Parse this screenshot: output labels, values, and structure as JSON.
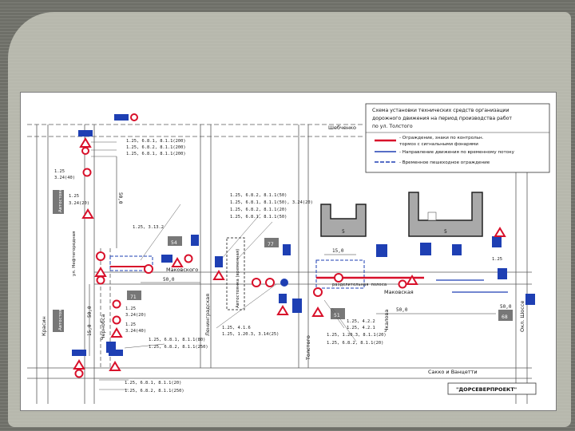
{
  "legend": {
    "title_lines": [
      "Схема установки технических средств организации",
      "дорожного движения на период производства работ",
      "по ул. Толстого"
    ],
    "items": [
      "- Ограждение, знаки по контрольн.",
      "тормоз с сигнальными фонарями",
      "- Направление движения по временному потоку",
      "- Временное пешеходное ограждение"
    ]
  },
  "streets": {
    "top": "Шебченко",
    "makovskogo_left": "Маковского",
    "makovskogo_right": "Маковская",
    "chernovsa": "Чернобса",
    "leningradskaya": "Ленинградская",
    "tolstogo": "Толстого",
    "sakko": "Сакко и Ванцетти",
    "chkalov": "Чкалова",
    "krasin": "Красин",
    "bottom_right_vert": "Окл. Шоссе"
  },
  "tall_labels": {
    "left_mid": "Автостоянка",
    "left_low": "Автостоянка",
    "center_box": "Автостоянка (временная)",
    "left_vert_street": "ул. Нефтегородная"
  },
  "building_numbers": {
    "b54": "54",
    "b77": "77",
    "b71": "71",
    "b51": "51",
    "b68": "68",
    "b5a": "5",
    "b5b": "5"
  },
  "dimensions": {
    "d500_h1": "50,0",
    "d500_h2": "50,0",
    "d500_v1": "50,0",
    "d500_v2": "50,0",
    "d150": "15,0",
    "d150_b": "15,0",
    "d500_right": "50,0"
  },
  "sign_notes": {
    "n1": "1.25,  6.8.1, 8.1.1(200)",
    "n2": "1.25,  6.8.2, 8.1.1(200)",
    "n3": "1.25,  6.8.1, 8.1.1(200)",
    "n4": "1.25,  3.13.2",
    "n5": "1.25,  6.8.2, 8.1.1(50)",
    "n6": "1.25,  6.8.1, 8.1.1(50), 3.24(20)",
    "n7": "1.25,  6.8.2, 8.1.1(20)",
    "n8": "1.25,  6.8.1, 8.1.1(50)",
    "n9": "1.25",
    "n10": "3.24(40)",
    "n11": "1.25",
    "n12": "3.24(20)",
    "n13": "1.25,  6.8.1, 8.1.1(20)",
    "n14": "1.25,  6.8.2, 8.1.1(250)",
    "n15": "1.25,  4.1.6",
    "n16": "1.25,  1.20.3, 3.14(25)",
    "n17": "1.25,  4.2.2",
    "n18": "1.25,  4.2.1",
    "n19": "1.25,  1.20.3, 8.1.1(20)",
    "n20": "1.25,  6.8.2, 8.1.1(20)",
    "n21": "1.25,  6.8.1, 8.1.1(80)",
    "n22": "1.25,  6.8.2, 8.1.1(250)",
    "n23": "1.25",
    "n24": "3.24(20)",
    "n25": "1.25",
    "n26": "3.24(40)",
    "n27": "разделительная полоса",
    "n28": "Маковская",
    "n29": "1.25"
  },
  "stamp": "\"ДОРСЕВЕРПРОЕКТ\"",
  "colors": {
    "frame_gray": "#6e6f68",
    "panel_gray": "#b7b8ad",
    "sign_red": "#d8102a",
    "sign_blue": "#1e3fb3",
    "road_line": "#4a4a4a",
    "building_gray": "#a9a9a9"
  }
}
